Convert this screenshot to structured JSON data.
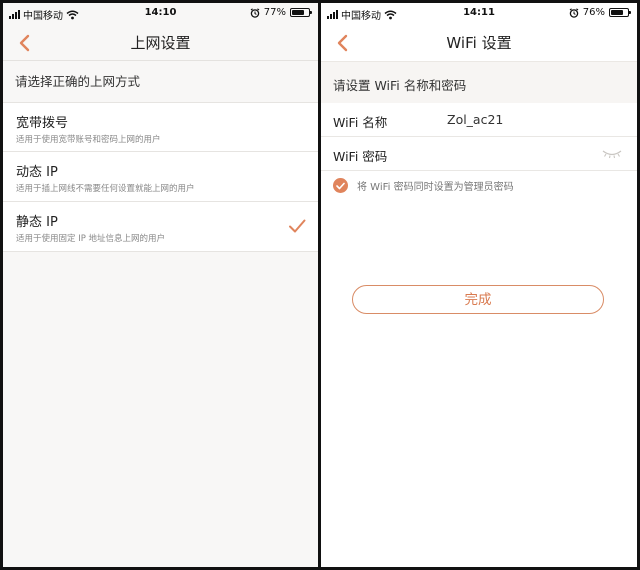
{
  "accent_color": "#e0845c",
  "left_screen": {
    "status_bar": {
      "carrier": "中国移动",
      "time": "14:10",
      "battery": "77%",
      "battery_level": 0.77,
      "icons": [
        "signal-icon",
        "wifi-icon",
        "alarm-icon",
        "battery-icon"
      ]
    },
    "nav": {
      "back_icon": "chevron-left-icon",
      "title": "上网设置"
    },
    "section_header": "请选择正确的上网方式",
    "options": [
      {
        "title": "宽带拨号",
        "desc": "适用于使用宽带账号和密码上网的用户",
        "selected": false
      },
      {
        "title": "动态 IP",
        "desc": "适用于插上网线不需要任何设置就能上网的用户",
        "selected": false
      },
      {
        "title": "静态 IP",
        "desc": "适用于使用固定 IP 地址信息上网的用户",
        "selected": true
      }
    ],
    "selected_icon": "checkmark-icon"
  },
  "right_screen": {
    "status_bar": {
      "carrier": "中国移动",
      "time": "14:11",
      "battery": "76%",
      "battery_level": 0.76,
      "icons": [
        "signal-icon",
        "wifi-icon",
        "alarm-icon",
        "battery-icon"
      ]
    },
    "nav": {
      "back_icon": "chevron-left-icon",
      "title": "WiFi 设置"
    },
    "section_header": "请设置 WiFi 名称和密码",
    "wifi_name_label": "WiFi 名称",
    "wifi_name_value": "Zol_ac21",
    "wifi_password_label": "WiFi 密码",
    "wifi_password_value": "",
    "password_toggle_icon": "eye-closed-icon",
    "sync_admin_label": "将 WiFi 密码同时设置为管理员密码",
    "sync_admin_checked": true,
    "done_button": "完成"
  }
}
